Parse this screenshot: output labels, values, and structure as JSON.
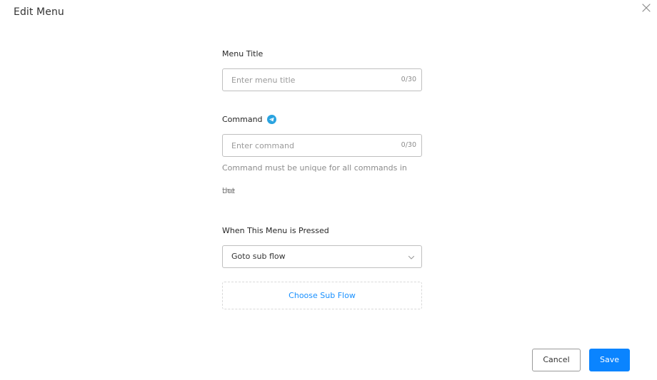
{
  "dialog": {
    "title": "Edit Menu",
    "close_icon": "close-icon"
  },
  "form": {
    "menu_title": {
      "label": "Menu Title",
      "placeholder": "Enter menu title",
      "value": "",
      "counter": "0/30"
    },
    "command": {
      "label": "Command",
      "icon": "telegram-icon",
      "placeholder": "Enter command",
      "value": "",
      "counter": "0/30",
      "help_line1": "Command must be unique for all commands in the",
      "help_line2": "bot"
    },
    "on_press": {
      "label": "When This Menu is Pressed",
      "selected": "Goto sub flow",
      "icon": "chevron-down-icon"
    },
    "choose_sub_flow_label": "Choose Sub Flow"
  },
  "footer": {
    "cancel_label": "Cancel",
    "save_label": "Save"
  },
  "colors": {
    "accent": "#0a84ff",
    "link": "#1890ff",
    "telegram": "#2aa3e0",
    "border": "#bfbfbf",
    "muted_text": "#8c8c8c"
  }
}
